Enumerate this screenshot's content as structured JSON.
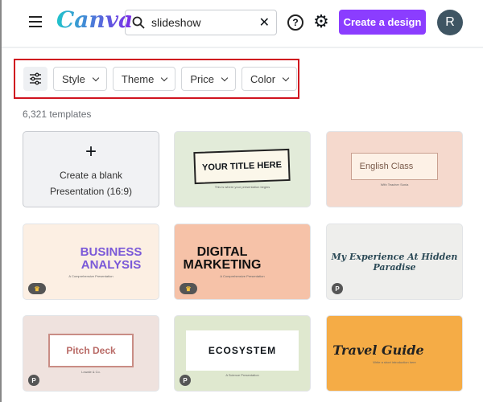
{
  "header": {
    "logo": "Canva",
    "search_value": "slideshow",
    "search_placeholder": "Search",
    "create_label": "Create a design",
    "avatar_initial": "R",
    "help_glyph": "?",
    "gear_glyph": "⚙",
    "clear_glyph": "✕"
  },
  "filters": [
    {
      "label": "Style"
    },
    {
      "label": "Theme"
    },
    {
      "label": "Price"
    },
    {
      "label": "Color"
    }
  ],
  "count": "6,321 templates",
  "blank": {
    "plus": "+",
    "line1": "Create a blank",
    "line2": "Presentation (16:9)"
  },
  "templates": [
    {
      "title": "YOUR TITLE HERE",
      "sub": "This is where your presentation begins",
      "bg": "#e2ebd9",
      "badge": ""
    },
    {
      "title": "English Class",
      "sub": "With Teacher Sonia",
      "bg": "#f5d9cd",
      "badge": ""
    },
    {
      "title": "BUSINESS ANALYSIS",
      "sub": "A Comprehensive Presentation",
      "bg": "#fcefe3",
      "badge": "crown"
    },
    {
      "title": "DIGITAL MARKETING",
      "sub": "A Comprehensive Presentation",
      "bg": "#f6c2a8",
      "badge": "crown"
    },
    {
      "title": "My Experience At Hidden Paradise",
      "sub": "",
      "bg": "#eeeeec",
      "badge": "P"
    },
    {
      "title": "Pitch Deck",
      "sub": "Lowale & Co.",
      "bg": "#efe2de",
      "badge": "P"
    },
    {
      "title": "ECOSYSTEM",
      "sub": "A Science Presentation",
      "bg": "#dfe8cf",
      "badge": "P"
    },
    {
      "title": "Travel Guide",
      "sub": "Write a short introduction here",
      "bg": "#f5ac46",
      "badge": ""
    }
  ],
  "colors": {
    "accent": "#8b3dff",
    "highlight_box": "#d0131f",
    "avatar": "#3f5563"
  }
}
